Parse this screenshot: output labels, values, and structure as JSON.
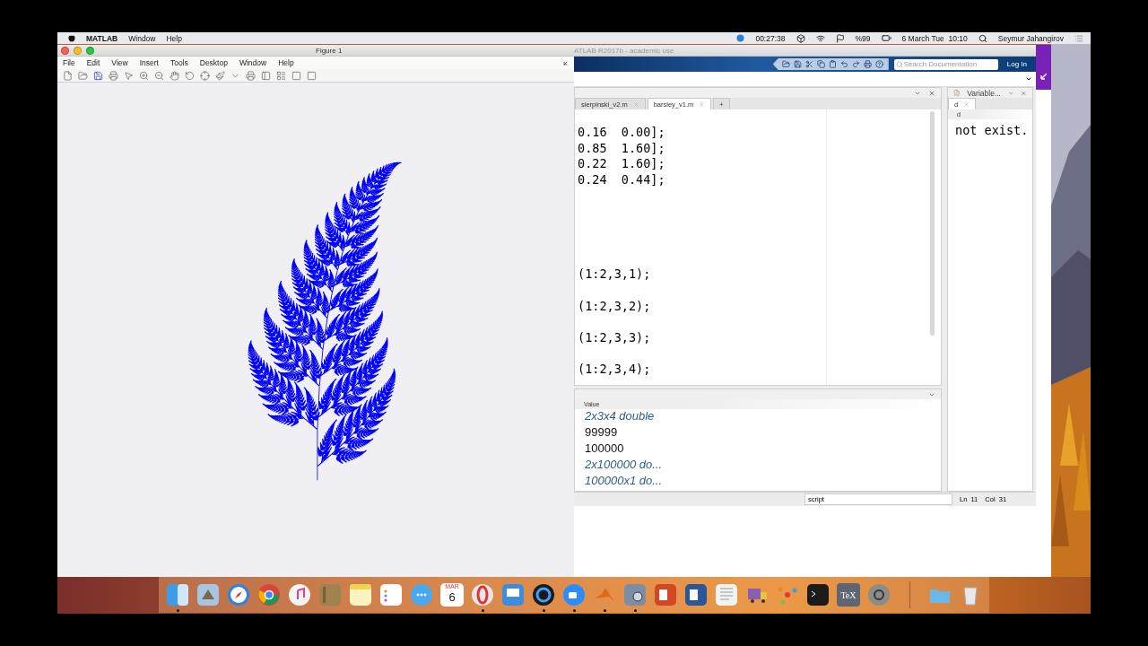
{
  "menubar": {
    "app": "MATLAB",
    "menus": [
      "Window",
      "Help"
    ],
    "clock": "00:27:38",
    "battery": "%99",
    "datetime": "6 March Tue  10:10",
    "user": "Seymur Jahangirov"
  },
  "figure": {
    "title": "Figure 1",
    "menus": [
      "File",
      "Edit",
      "View",
      "Insert",
      "Tools",
      "Desktop",
      "Window",
      "Help"
    ]
  },
  "matlab": {
    "title": "ATLAB R2017b - academic use",
    "search": {
      "placeholder": "Search Documentation"
    },
    "login": "Log In",
    "editor_tabs": [
      {
        "label": "sierpinski_v2.m",
        "selected": false
      },
      {
        "label": "barsley_v1.m",
        "selected": true
      }
    ],
    "add_tab": "+",
    "code_lines": [
      {
        "text": "0.16  0.00];",
        "kind": "next"
      },
      {
        "text": "0.85  1.60];",
        "kind": "next"
      },
      {
        "text": "0.22  1.60];",
        "kind": "next"
      },
      {
        "text": "0.24  0.44];",
        "kind": "next"
      },
      {
        "text": "(1:2,3,1);",
        "kind": "after_gap"
      },
      {
        "text": "(1:2,3,2);",
        "kind": "after_blank"
      },
      {
        "text": "(1:2,3,3);",
        "kind": "after_blank"
      },
      {
        "text": "(1:2,3,4);",
        "kind": "after_blank"
      }
    ],
    "variables": {
      "title": "Variable...",
      "tab": "d",
      "column": "d",
      "message": "not exist."
    },
    "workspace": {
      "column": "Value",
      "rows": [
        {
          "value": "2x3x4 double",
          "kind": "summary"
        },
        {
          "value": "99999",
          "kind": "plain"
        },
        {
          "value": "100000",
          "kind": "plain"
        },
        {
          "value": "2x100000 do...",
          "kind": "summary"
        },
        {
          "value": "100000x1 do...",
          "kind": "summary"
        }
      ]
    },
    "status": {
      "mode": "script",
      "line": "Ln  11",
      "col": "Col  31"
    }
  },
  "dock": {
    "items": [
      {
        "kind": "finder",
        "running": true
      },
      {
        "kind": "preview",
        "running": false
      },
      {
        "kind": "safari",
        "running": false
      },
      {
        "kind": "chrome",
        "running": false
      },
      {
        "kind": "music",
        "running": false
      },
      {
        "kind": "notebook",
        "running": false
      },
      {
        "kind": "notes",
        "running": false
      },
      {
        "kind": "reminders",
        "running": false
      },
      {
        "kind": "messages",
        "running": false
      },
      {
        "kind": "calendar",
        "month": "MAR",
        "day": "6",
        "running": false
      },
      {
        "kind": "opera",
        "running": true
      },
      {
        "kind": "keynote",
        "running": false
      },
      {
        "kind": "quicktime",
        "running": true
      },
      {
        "kind": "zoom",
        "running": true
      },
      {
        "kind": "matlab",
        "running": true
      },
      {
        "kind": "photos",
        "running": true
      },
      {
        "kind": "powerpoint",
        "running": false
      },
      {
        "kind": "word",
        "running": false
      },
      {
        "kind": "textedit",
        "running": false
      },
      {
        "kind": "transmit",
        "running": false
      },
      {
        "kind": "network",
        "running": false
      },
      {
        "kind": "terminal",
        "running": false
      },
      {
        "kind": "texmaker",
        "label": "TeX",
        "running": false
      },
      {
        "kind": "settings",
        "running": false
      },
      {
        "kind": "separator",
        "running": false
      },
      {
        "kind": "folder",
        "running": false
      },
      {
        "kind": "trash",
        "running": false
      }
    ]
  }
}
